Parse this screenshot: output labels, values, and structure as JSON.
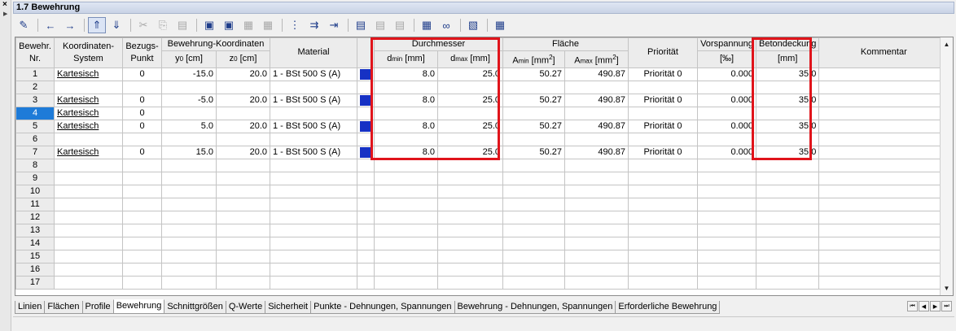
{
  "panel": {
    "title": "1.7 Bewehrung"
  },
  "toolbar": {
    "buttons": [
      {
        "name": "edit-icon",
        "glyph": "✎"
      },
      {
        "name": "arrow-left-icon",
        "glyph": "←"
      },
      {
        "name": "arrow-right-icon",
        "glyph": "→"
      },
      {
        "name": "sort-up-icon",
        "glyph": "⇑"
      },
      {
        "name": "sort-down-icon",
        "glyph": "⇓"
      },
      {
        "name": "cut-icon",
        "glyph": "✂"
      },
      {
        "name": "copy-icon",
        "glyph": "⎘"
      },
      {
        "name": "paste-icon",
        "glyph": "▤"
      },
      {
        "name": "view-1-icon",
        "glyph": "▣"
      },
      {
        "name": "view-2-icon",
        "glyph": "▣"
      },
      {
        "name": "view-3-icon",
        "glyph": "▦"
      },
      {
        "name": "view-4-icon",
        "glyph": "▦"
      },
      {
        "name": "delete-row-icon",
        "glyph": "⋮"
      },
      {
        "name": "insert-row-icon",
        "glyph": "⇉"
      },
      {
        "name": "append-row-icon",
        "glyph": "⇥"
      },
      {
        "name": "table-1-icon",
        "glyph": "▤"
      },
      {
        "name": "table-2-icon",
        "glyph": "▤"
      },
      {
        "name": "table-3-icon",
        "glyph": "▤"
      },
      {
        "name": "grid-icon",
        "glyph": "▦"
      },
      {
        "name": "view-glasses-icon",
        "glyph": "∞"
      },
      {
        "name": "export-icon",
        "glyph": "▧"
      },
      {
        "name": "calculator-icon",
        "glyph": "▦"
      }
    ]
  },
  "table": {
    "headers": {
      "nr_1": "Bewehr.",
      "nr_2": "Nr.",
      "ks_1": "Koordinaten-",
      "ks_2": "System",
      "bp_1": "Bezugs-",
      "bp_2": "Punkt",
      "bk": "Bewehrung-Koordinaten",
      "y0_a": "y",
      "y0_b": "0",
      "y0_c": " [cm]",
      "z0_a": "z",
      "z0_b": "0",
      "z0_c": " [cm]",
      "mat": "Material",
      "dm": "Durchmesser",
      "dmin_a": "d",
      "dmin_b": "min",
      "dmin_c": " [mm]",
      "dmax_a": "d",
      "dmax_b": "max",
      "dmax_c": " [mm]",
      "fl": "Fläche",
      "amin_a": "A",
      "amin_b": "min",
      "amin_c": " [mm",
      "amin_d": "2",
      "amin_e": "]",
      "amax_a": "A",
      "amax_b": "max",
      "amax_c": " [mm",
      "amax_d": "2",
      "amax_e": "]",
      "prio": "Priorität",
      "vs": "Vorspannung",
      "vs_unit": "[‰]",
      "bd": "Betondeckung",
      "bd_unit": "[mm]",
      "kom": "Kommentar"
    },
    "rows": [
      {
        "nr": "1",
        "ks": "Kartesisch",
        "bp": "0",
        "y0": "-15.0",
        "z0": "20.0",
        "mat": "1 - BSt 500 S (A)",
        "dmin": "8.0",
        "dmax": "25.0",
        "amin": "50.27",
        "amax": "490.87",
        "prio": "Priorität 0",
        "vs": "0.000",
        "bd": "35.0",
        "kom": ""
      },
      {
        "nr": "2",
        "ks": "",
        "bp": "",
        "y0": "",
        "z0": "",
        "mat": "",
        "dmin": "",
        "dmax": "",
        "amin": "",
        "amax": "",
        "prio": "",
        "vs": "",
        "bd": "",
        "kom": ""
      },
      {
        "nr": "3",
        "ks": "Kartesisch",
        "bp": "0",
        "y0": "-5.0",
        "z0": "20.0",
        "mat": "1 - BSt 500 S (A)",
        "dmin": "8.0",
        "dmax": "25.0",
        "amin": "50.27",
        "amax": "490.87",
        "prio": "Priorität 0",
        "vs": "0.000",
        "bd": "35.0",
        "kom": ""
      },
      {
        "nr": "4",
        "ks": "Kartesisch",
        "bp": "0",
        "y0": "",
        "z0": "",
        "mat": "",
        "dmin": "",
        "dmax": "",
        "amin": "",
        "amax": "",
        "prio": "",
        "vs": "",
        "bd": "",
        "kom": ""
      },
      {
        "nr": "5",
        "ks": "Kartesisch",
        "bp": "0",
        "y0": "5.0",
        "z0": "20.0",
        "mat": "1 - BSt 500 S (A)",
        "dmin": "8.0",
        "dmax": "25.0",
        "amin": "50.27",
        "amax": "490.87",
        "prio": "Priorität 0",
        "vs": "0.000",
        "bd": "35.0",
        "kom": ""
      },
      {
        "nr": "6",
        "ks": "",
        "bp": "",
        "y0": "",
        "z0": "",
        "mat": "",
        "dmin": "",
        "dmax": "",
        "amin": "",
        "amax": "",
        "prio": "",
        "vs": "",
        "bd": "",
        "kom": ""
      },
      {
        "nr": "7",
        "ks": "Kartesisch",
        "bp": "0",
        "y0": "15.0",
        "z0": "20.0",
        "mat": "1 - BSt 500 S (A)",
        "dmin": "8.0",
        "dmax": "25.0",
        "amin": "50.27",
        "amax": "490.87",
        "prio": "Priorität 0",
        "vs": "0.000",
        "bd": "35.0",
        "kom": ""
      },
      {
        "nr": "8",
        "ks": "",
        "bp": "",
        "y0": "",
        "z0": "",
        "mat": "",
        "dmin": "",
        "dmax": "",
        "amin": "",
        "amax": "",
        "prio": "",
        "vs": "",
        "bd": "",
        "kom": ""
      },
      {
        "nr": "9",
        "ks": "",
        "bp": "",
        "y0": "",
        "z0": "",
        "mat": "",
        "dmin": "",
        "dmax": "",
        "amin": "",
        "amax": "",
        "prio": "",
        "vs": "",
        "bd": "",
        "kom": ""
      },
      {
        "nr": "10",
        "ks": "",
        "bp": "",
        "y0": "",
        "z0": "",
        "mat": "",
        "dmin": "",
        "dmax": "",
        "amin": "",
        "amax": "",
        "prio": "",
        "vs": "",
        "bd": "",
        "kom": ""
      },
      {
        "nr": "11",
        "ks": "",
        "bp": "",
        "y0": "",
        "z0": "",
        "mat": "",
        "dmin": "",
        "dmax": "",
        "amin": "",
        "amax": "",
        "prio": "",
        "vs": "",
        "bd": "",
        "kom": ""
      },
      {
        "nr": "12",
        "ks": "",
        "bp": "",
        "y0": "",
        "z0": "",
        "mat": "",
        "dmin": "",
        "dmax": "",
        "amin": "",
        "amax": "",
        "prio": "",
        "vs": "",
        "bd": "",
        "kom": ""
      },
      {
        "nr": "13",
        "ks": "",
        "bp": "",
        "y0": "",
        "z0": "",
        "mat": "",
        "dmin": "",
        "dmax": "",
        "amin": "",
        "amax": "",
        "prio": "",
        "vs": "",
        "bd": "",
        "kom": ""
      },
      {
        "nr": "14",
        "ks": "",
        "bp": "",
        "y0": "",
        "z0": "",
        "mat": "",
        "dmin": "",
        "dmax": "",
        "amin": "",
        "amax": "",
        "prio": "",
        "vs": "",
        "bd": "",
        "kom": ""
      },
      {
        "nr": "15",
        "ks": "",
        "bp": "",
        "y0": "",
        "z0": "",
        "mat": "",
        "dmin": "",
        "dmax": "",
        "amin": "",
        "amax": "",
        "prio": "",
        "vs": "",
        "bd": "",
        "kom": ""
      },
      {
        "nr": "16",
        "ks": "",
        "bp": "",
        "y0": "",
        "z0": "",
        "mat": "",
        "dmin": "",
        "dmax": "",
        "amin": "",
        "amax": "",
        "prio": "",
        "vs": "",
        "bd": "",
        "kom": ""
      },
      {
        "nr": "17",
        "ks": "",
        "bp": "",
        "y0": "",
        "z0": "",
        "mat": "",
        "dmin": "",
        "dmax": "",
        "amin": "",
        "amax": "",
        "prio": "",
        "vs": "",
        "bd": "",
        "kom": ""
      }
    ],
    "selected_row": "4",
    "material_color": "#1631c4",
    "selection_color": "#1e7bd8",
    "highlight_color": "#e0141b"
  },
  "tabs": [
    {
      "label": "Linien",
      "active": false
    },
    {
      "label": "Flächen",
      "active": false
    },
    {
      "label": "Profile",
      "active": false
    },
    {
      "label": "Bewehrung",
      "active": true
    },
    {
      "label": "Schnittgrößen",
      "active": false
    },
    {
      "label": "Q-Werte",
      "active": false
    },
    {
      "label": "Sicherheit",
      "active": false
    },
    {
      "label": "Punkte - Dehnungen, Spannungen",
      "active": false
    },
    {
      "label": "Bewehrung - Dehnungen, Spannungen",
      "active": false
    },
    {
      "label": "Erforderliche Bewehrung",
      "active": false
    }
  ]
}
